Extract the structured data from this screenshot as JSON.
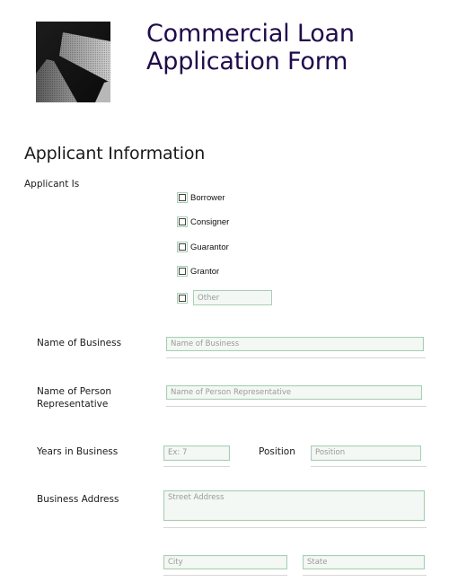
{
  "header": {
    "title_line1": "Commercial Loan",
    "title_line2": "Application Form",
    "logo": "skyscraper-photo",
    "title_color": "#1f0b4b"
  },
  "section": {
    "title": "Applicant Information"
  },
  "applicant_is": {
    "label": "Applicant Is",
    "options": [
      {
        "label": "Borrower",
        "checked": false
      },
      {
        "label": "Consigner",
        "checked": false
      },
      {
        "label": "Guarantor",
        "checked": false
      },
      {
        "label": "Grantor",
        "checked": false
      }
    ],
    "other": {
      "checked": false,
      "placeholder": "Other",
      "value": ""
    }
  },
  "fields": {
    "business_name": {
      "label": "Name of Business",
      "placeholder": "Name of Business",
      "value": ""
    },
    "representative": {
      "label": "Name of Person Representative",
      "placeholder": "Name of Person Representative",
      "value": ""
    },
    "years": {
      "label": "Years in Business",
      "placeholder": "Ex: 7",
      "value": ""
    },
    "position": {
      "label": "Position",
      "placeholder": "Position",
      "value": ""
    },
    "address": {
      "label": "Business Address",
      "street_placeholder": "Street Address",
      "city_placeholder": "City",
      "state_placeholder": "State"
    }
  },
  "colors": {
    "input_border": "#a8cfb4",
    "input_background": "#f3f8f4",
    "placeholder": "#9a9a9a"
  }
}
